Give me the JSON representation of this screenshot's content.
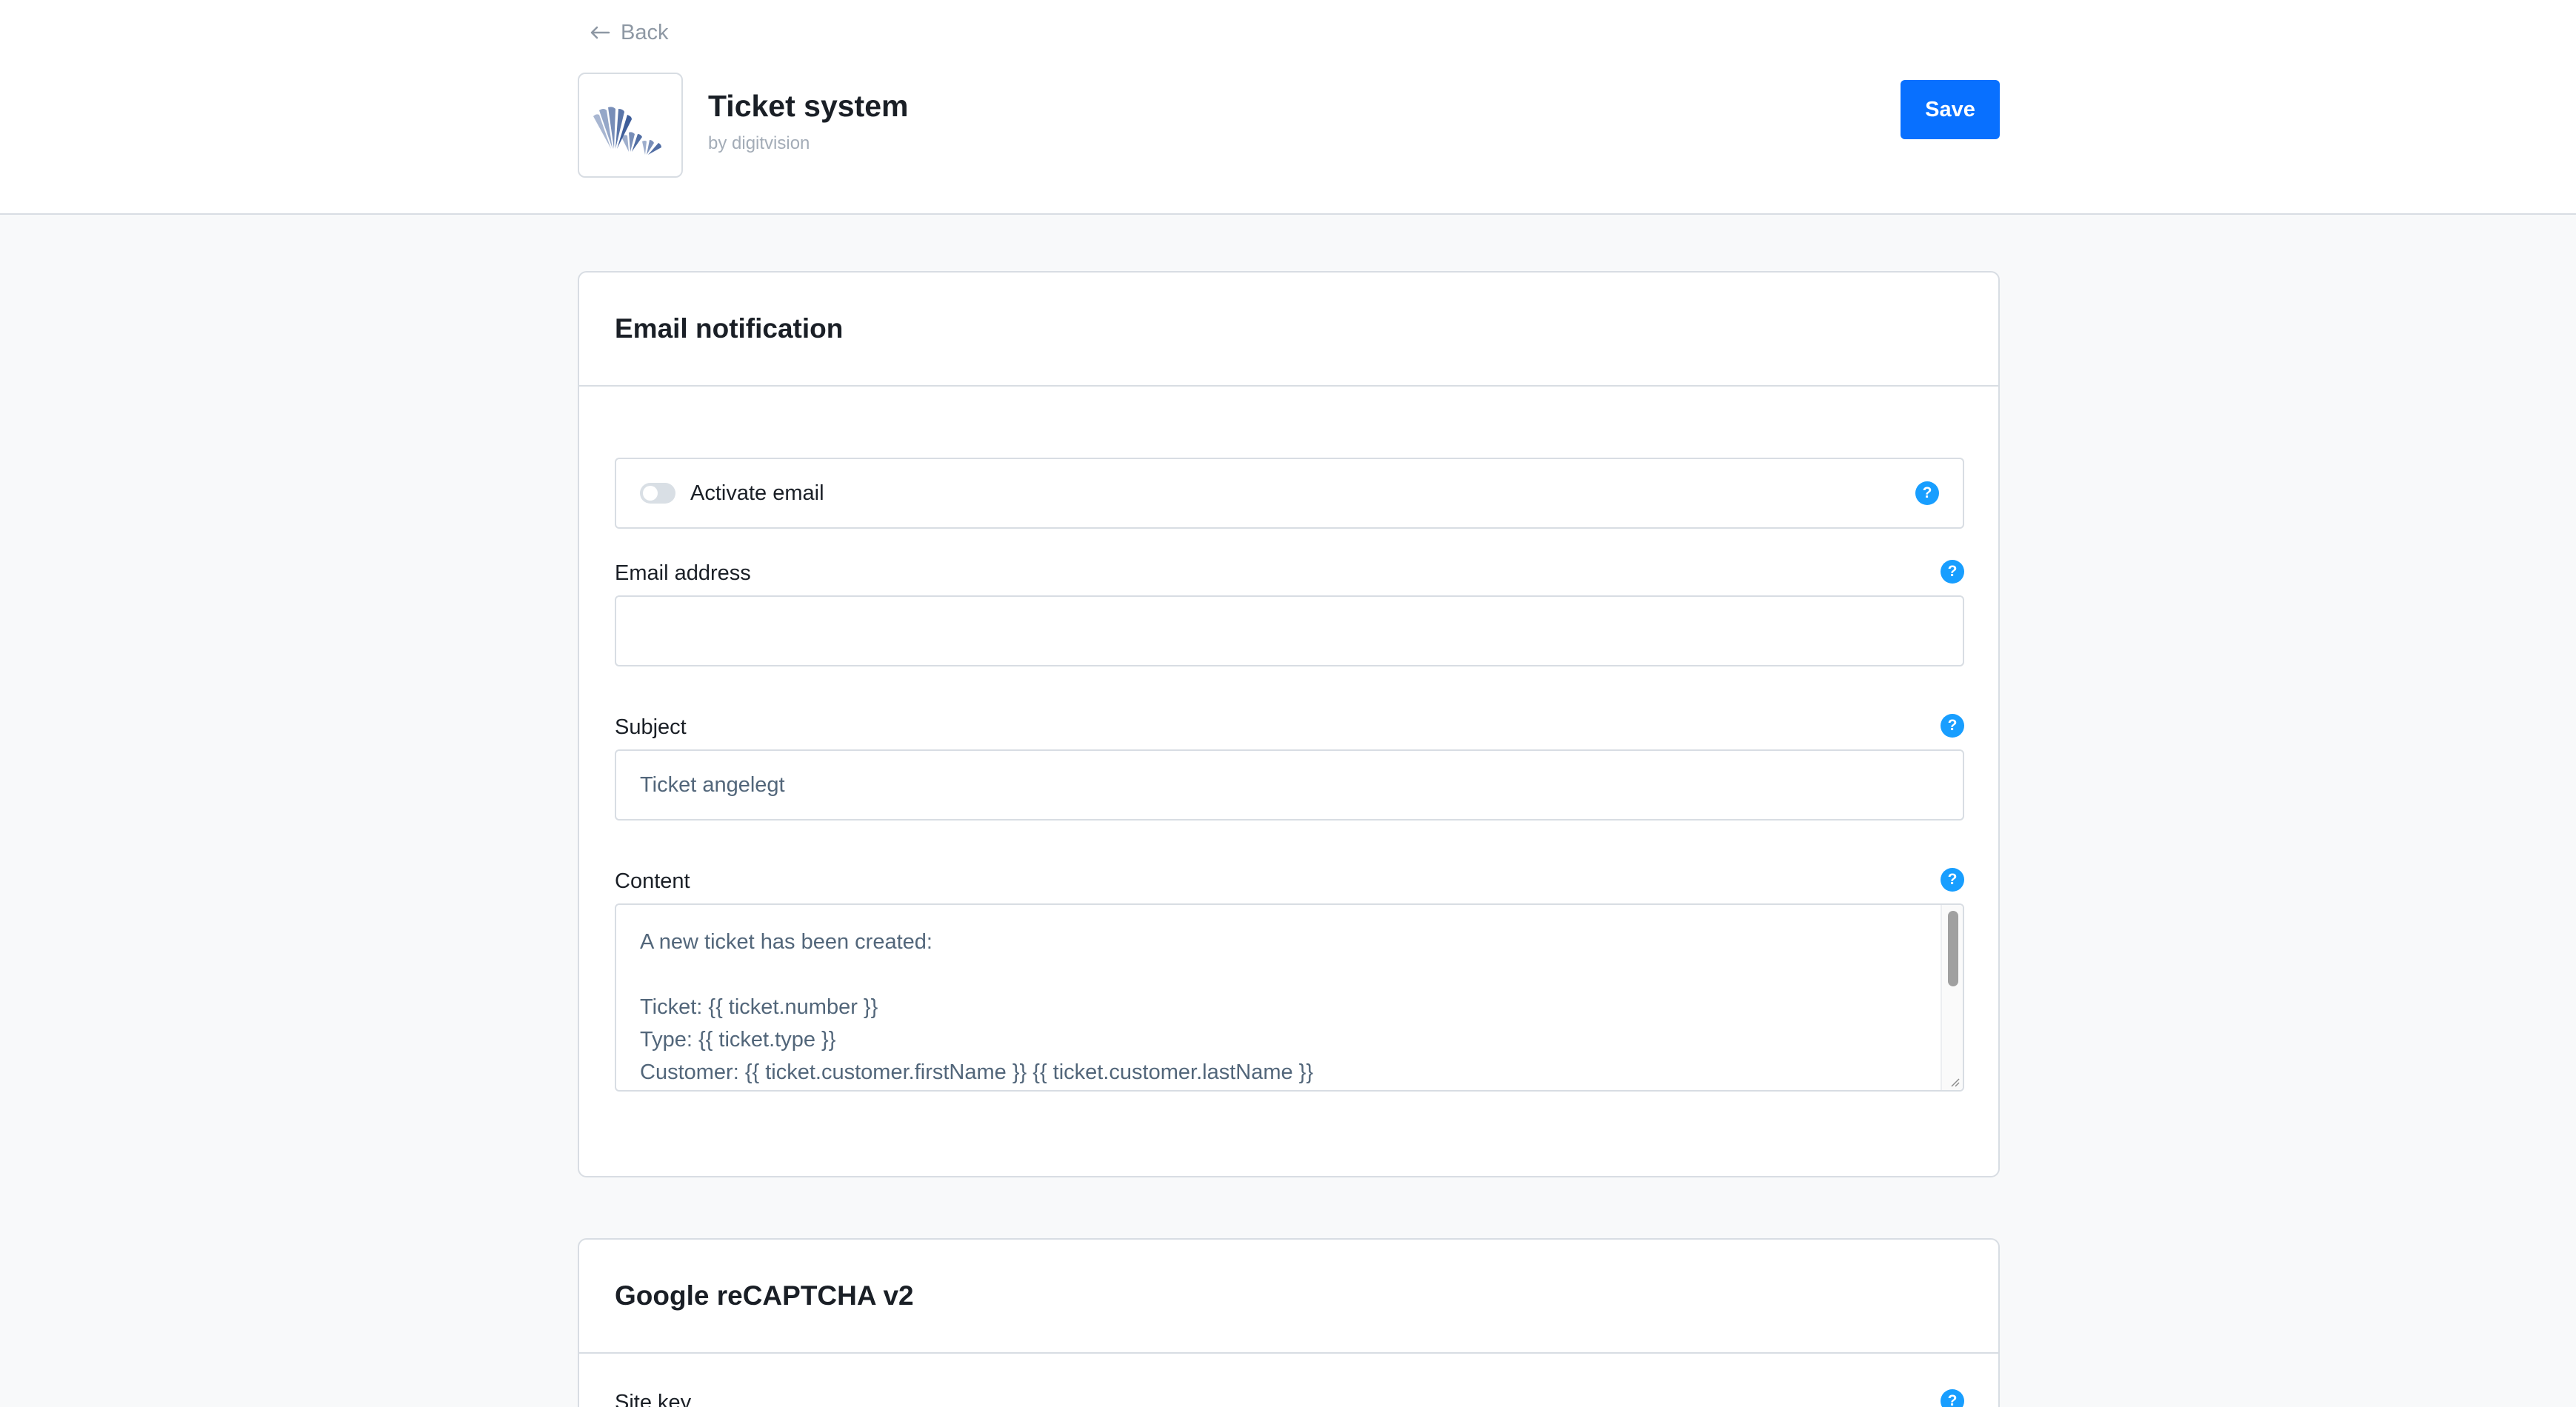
{
  "header": {
    "back_label": "Back",
    "app_title": "Ticket system",
    "app_byline": "by digitvision",
    "save_label": "Save"
  },
  "email_card": {
    "title": "Email notification",
    "activate_email": {
      "label": "Activate email",
      "enabled": false
    },
    "email_address": {
      "label": "Email address",
      "value": ""
    },
    "subject": {
      "label": "Subject",
      "value": "Ticket angelegt"
    },
    "content": {
      "label": "Content",
      "lines": [
        "A new ticket has been created:",
        "",
        "Ticket: {{ ticket.number }}",
        "Type: {{ ticket.type }}",
        "Customer: {{ ticket.customer.firstName }} {{ ticket.customer.lastName }}"
      ]
    },
    "help_glyph": "?"
  },
  "recaptcha_card": {
    "title": "Google reCAPTCHA v2",
    "site_key": {
      "label": "Site key"
    }
  },
  "colors": {
    "accent": "#0870ff",
    "help": "#189eff",
    "border": "#d8dde3",
    "page_bg": "#f8f9fa"
  },
  "icons": {
    "back": "arrow-left-icon",
    "help": "question-circle-icon",
    "logo": "digitvision-logo"
  }
}
